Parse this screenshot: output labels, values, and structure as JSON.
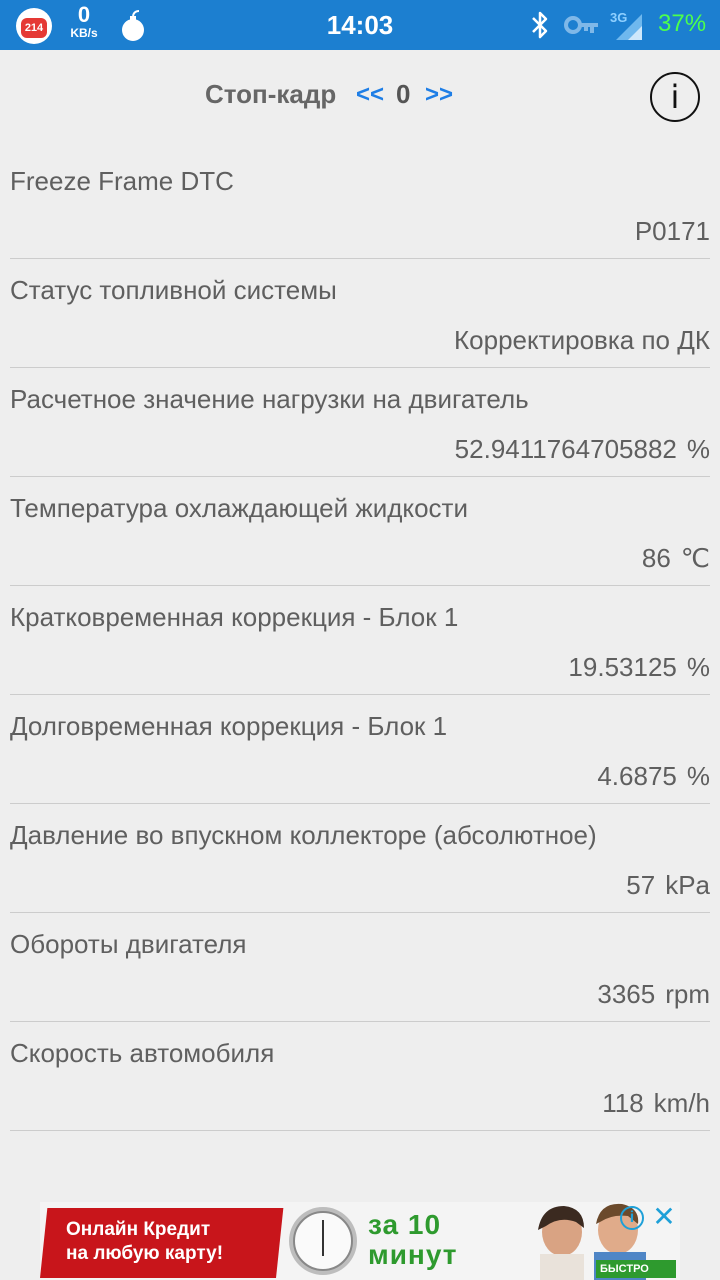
{
  "status_bar": {
    "badge_count": "214",
    "net_speed_value": "0",
    "net_speed_unit": "KB/s",
    "network_type": "3G",
    "time": "14:03",
    "battery": "37%",
    "icons": [
      "notification-badge-icon",
      "bomb-icon",
      "bluetooth-icon",
      "key-icon",
      "signal-icon"
    ]
  },
  "header": {
    "title": "Стоп-кадр",
    "prev": "<<",
    "frame_number": "0",
    "next": ">>",
    "info": "i"
  },
  "rows": [
    {
      "label": "Freeze Frame DTC",
      "value": "P0171",
      "unit": ""
    },
    {
      "label": "Статус топливной системы",
      "value": "Корректировка по ДК",
      "unit": ""
    },
    {
      "label": "Расчетное значение нагрузки на двигатель",
      "value": "52.9411764705882",
      "unit": "%"
    },
    {
      "label": "Температура охлаждающей жидкости",
      "value": "86",
      "unit": "℃"
    },
    {
      "label": "Кратковременная коррекция - Блок 1",
      "value": "19.53125",
      "unit": "%"
    },
    {
      "label": "Долговременная коррекция - Блок 1",
      "value": "4.6875",
      "unit": "%"
    },
    {
      "label": "Давление во впускном коллекторе (абсолютное)",
      "value": "57",
      "unit": "kPa"
    },
    {
      "label": "Обороты двигателя",
      "value": "3365",
      "unit": "rpm"
    },
    {
      "label": "Скорость автомобиля",
      "value": "118",
      "unit": "km/h"
    }
  ],
  "ad": {
    "line1": "Онлайн Кредит",
    "line2": "на любую карту!",
    "za_line1": "за 10",
    "za_line2": "минут",
    "brand": "БЫСТРО ЗАЙМ",
    "info": "i",
    "close": "✕"
  },
  "colors": {
    "status_bar": "#1c7fd0",
    "background": "#eeeeee",
    "nav_arrow": "#1e7ee6",
    "battery": "#4cff4c"
  }
}
